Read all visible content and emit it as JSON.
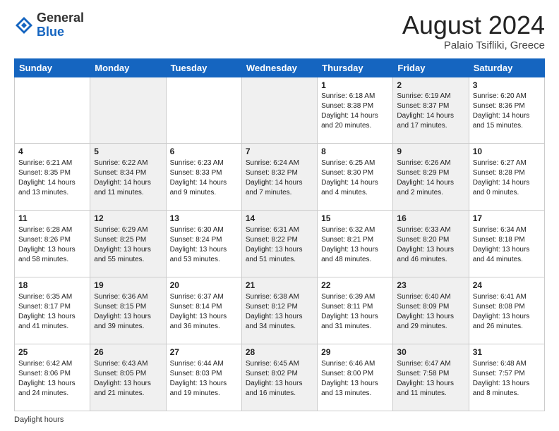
{
  "header": {
    "logo_general": "General",
    "logo_blue": "Blue",
    "month_title": "August 2024",
    "location": "Palaio Tsifliki, Greece"
  },
  "days_of_week": [
    "Sunday",
    "Monday",
    "Tuesday",
    "Wednesday",
    "Thursday",
    "Friday",
    "Saturday"
  ],
  "weeks": [
    [
      {
        "day": "",
        "info": "",
        "shaded": false
      },
      {
        "day": "",
        "info": "",
        "shaded": true
      },
      {
        "day": "",
        "info": "",
        "shaded": false
      },
      {
        "day": "",
        "info": "",
        "shaded": true
      },
      {
        "day": "1",
        "info": "Sunrise: 6:18 AM\nSunset: 8:38 PM\nDaylight: 14 hours and 20 minutes.",
        "shaded": false
      },
      {
        "day": "2",
        "info": "Sunrise: 6:19 AM\nSunset: 8:37 PM\nDaylight: 14 hours and 17 minutes.",
        "shaded": true
      },
      {
        "day": "3",
        "info": "Sunrise: 6:20 AM\nSunset: 8:36 PM\nDaylight: 14 hours and 15 minutes.",
        "shaded": false
      }
    ],
    [
      {
        "day": "4",
        "info": "Sunrise: 6:21 AM\nSunset: 8:35 PM\nDaylight: 14 hours and 13 minutes.",
        "shaded": false
      },
      {
        "day": "5",
        "info": "Sunrise: 6:22 AM\nSunset: 8:34 PM\nDaylight: 14 hours and 11 minutes.",
        "shaded": true
      },
      {
        "day": "6",
        "info": "Sunrise: 6:23 AM\nSunset: 8:33 PM\nDaylight: 14 hours and 9 minutes.",
        "shaded": false
      },
      {
        "day": "7",
        "info": "Sunrise: 6:24 AM\nSunset: 8:32 PM\nDaylight: 14 hours and 7 minutes.",
        "shaded": true
      },
      {
        "day": "8",
        "info": "Sunrise: 6:25 AM\nSunset: 8:30 PM\nDaylight: 14 hours and 4 minutes.",
        "shaded": false
      },
      {
        "day": "9",
        "info": "Sunrise: 6:26 AM\nSunset: 8:29 PM\nDaylight: 14 hours and 2 minutes.",
        "shaded": true
      },
      {
        "day": "10",
        "info": "Sunrise: 6:27 AM\nSunset: 8:28 PM\nDaylight: 14 hours and 0 minutes.",
        "shaded": false
      }
    ],
    [
      {
        "day": "11",
        "info": "Sunrise: 6:28 AM\nSunset: 8:26 PM\nDaylight: 13 hours and 58 minutes.",
        "shaded": false
      },
      {
        "day": "12",
        "info": "Sunrise: 6:29 AM\nSunset: 8:25 PM\nDaylight: 13 hours and 55 minutes.",
        "shaded": true
      },
      {
        "day": "13",
        "info": "Sunrise: 6:30 AM\nSunset: 8:24 PM\nDaylight: 13 hours and 53 minutes.",
        "shaded": false
      },
      {
        "day": "14",
        "info": "Sunrise: 6:31 AM\nSunset: 8:22 PM\nDaylight: 13 hours and 51 minutes.",
        "shaded": true
      },
      {
        "day": "15",
        "info": "Sunrise: 6:32 AM\nSunset: 8:21 PM\nDaylight: 13 hours and 48 minutes.",
        "shaded": false
      },
      {
        "day": "16",
        "info": "Sunrise: 6:33 AM\nSunset: 8:20 PM\nDaylight: 13 hours and 46 minutes.",
        "shaded": true
      },
      {
        "day": "17",
        "info": "Sunrise: 6:34 AM\nSunset: 8:18 PM\nDaylight: 13 hours and 44 minutes.",
        "shaded": false
      }
    ],
    [
      {
        "day": "18",
        "info": "Sunrise: 6:35 AM\nSunset: 8:17 PM\nDaylight: 13 hours and 41 minutes.",
        "shaded": false
      },
      {
        "day": "19",
        "info": "Sunrise: 6:36 AM\nSunset: 8:15 PM\nDaylight: 13 hours and 39 minutes.",
        "shaded": true
      },
      {
        "day": "20",
        "info": "Sunrise: 6:37 AM\nSunset: 8:14 PM\nDaylight: 13 hours and 36 minutes.",
        "shaded": false
      },
      {
        "day": "21",
        "info": "Sunrise: 6:38 AM\nSunset: 8:12 PM\nDaylight: 13 hours and 34 minutes.",
        "shaded": true
      },
      {
        "day": "22",
        "info": "Sunrise: 6:39 AM\nSunset: 8:11 PM\nDaylight: 13 hours and 31 minutes.",
        "shaded": false
      },
      {
        "day": "23",
        "info": "Sunrise: 6:40 AM\nSunset: 8:09 PM\nDaylight: 13 hours and 29 minutes.",
        "shaded": true
      },
      {
        "day": "24",
        "info": "Sunrise: 6:41 AM\nSunset: 8:08 PM\nDaylight: 13 hours and 26 minutes.",
        "shaded": false
      }
    ],
    [
      {
        "day": "25",
        "info": "Sunrise: 6:42 AM\nSunset: 8:06 PM\nDaylight: 13 hours and 24 minutes.",
        "shaded": false
      },
      {
        "day": "26",
        "info": "Sunrise: 6:43 AM\nSunset: 8:05 PM\nDaylight: 13 hours and 21 minutes.",
        "shaded": true
      },
      {
        "day": "27",
        "info": "Sunrise: 6:44 AM\nSunset: 8:03 PM\nDaylight: 13 hours and 19 minutes.",
        "shaded": false
      },
      {
        "day": "28",
        "info": "Sunrise: 6:45 AM\nSunset: 8:02 PM\nDaylight: 13 hours and 16 minutes.",
        "shaded": true
      },
      {
        "day": "29",
        "info": "Sunrise: 6:46 AM\nSunset: 8:00 PM\nDaylight: 13 hours and 13 minutes.",
        "shaded": false
      },
      {
        "day": "30",
        "info": "Sunrise: 6:47 AM\nSunset: 7:58 PM\nDaylight: 13 hours and 11 minutes.",
        "shaded": true
      },
      {
        "day": "31",
        "info": "Sunrise: 6:48 AM\nSunset: 7:57 PM\nDaylight: 13 hours and 8 minutes.",
        "shaded": false
      }
    ]
  ],
  "footer": {
    "daylight_label": "Daylight hours"
  }
}
